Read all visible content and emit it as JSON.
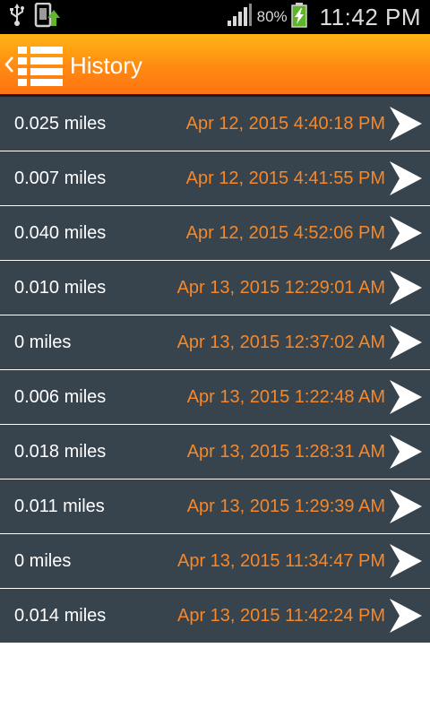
{
  "status_bar": {
    "battery_percent": "80%",
    "time": "11:42 PM",
    "icons": [
      "usb-icon",
      "phone-update-icon",
      "signal-icon",
      "battery-charging-icon"
    ]
  },
  "action_bar": {
    "title": "History",
    "back_icon": "chevron-left-icon",
    "app_icon": "list-icon"
  },
  "colors": {
    "action_bar_top": "#ffb414",
    "action_bar_bottom": "#ff7312",
    "row_background": "#37434d",
    "date_text": "#f6882a",
    "distance_text": "#ffffff"
  },
  "history": [
    {
      "distance": "0.025 miles",
      "date": "Apr 12, 2015 4:40:18 PM"
    },
    {
      "distance": "0.007 miles",
      "date": "Apr 12, 2015 4:41:55 PM"
    },
    {
      "distance": "0.040 miles",
      "date": "Apr 12, 2015 4:52:06 PM"
    },
    {
      "distance": "0.010 miles",
      "date": "Apr 13, 2015 12:29:01 AM"
    },
    {
      "distance": "0 miles",
      "date": "Apr 13, 2015 12:37:02 AM"
    },
    {
      "distance": "0.006 miles",
      "date": "Apr 13, 2015 1:22:48 AM"
    },
    {
      "distance": "0.018 miles",
      "date": "Apr 13, 2015 1:28:31 AM"
    },
    {
      "distance": "0.011 miles",
      "date": "Apr 13, 2015 1:29:39 AM"
    },
    {
      "distance": "0 miles",
      "date": "Apr 13, 2015 11:34:47 PM"
    },
    {
      "distance": "0.014 miles",
      "date": "Apr 13, 2015 11:42:24 PM"
    }
  ]
}
